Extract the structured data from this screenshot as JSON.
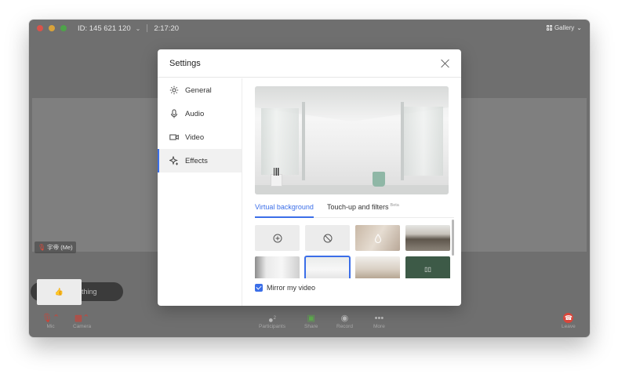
{
  "window": {
    "meeting_id": "ID: 145 621 120",
    "timer": "2:17:20",
    "view_label": "Gallery",
    "self_name": "宇帝 (Me)"
  },
  "chat": {
    "placeholder": "Say something"
  },
  "toolbar": {
    "mic_label": "Mic",
    "camera_label": "Camera",
    "participants_label": "Participants",
    "participants_count": "2",
    "share_label": "Share",
    "record_label": "Record",
    "more_label": "More",
    "leave_label": "Leave"
  },
  "settings": {
    "title": "Settings",
    "sidebar": [
      {
        "label": "General",
        "icon": "gear-icon"
      },
      {
        "label": "Audio",
        "icon": "microphone-icon"
      },
      {
        "label": "Video",
        "icon": "video-camera-icon"
      },
      {
        "label": "Effects",
        "icon": "sparkle-icon",
        "active": true
      }
    ],
    "tabs": {
      "virtual_background": "Virtual background",
      "touchup": "Touch-up and filters",
      "beta": "Beta"
    },
    "backgrounds": [
      {
        "kind": "add",
        "icon": "plus-circle-icon"
      },
      {
        "kind": "none",
        "icon": "ban-icon"
      },
      {
        "kind": "blur",
        "icon": "drop-icon"
      },
      {
        "kind": "image",
        "selected": false
      },
      {
        "kind": "image",
        "selected": false
      },
      {
        "kind": "image",
        "selected": true
      },
      {
        "kind": "image",
        "selected": false
      },
      {
        "kind": "image",
        "selected": false
      }
    ],
    "mirror_label": "Mirror my video",
    "mirror_checked": true
  },
  "colors": {
    "accent": "#3b6ee8",
    "leave": "#d9453a",
    "muted": "#c8453a"
  }
}
